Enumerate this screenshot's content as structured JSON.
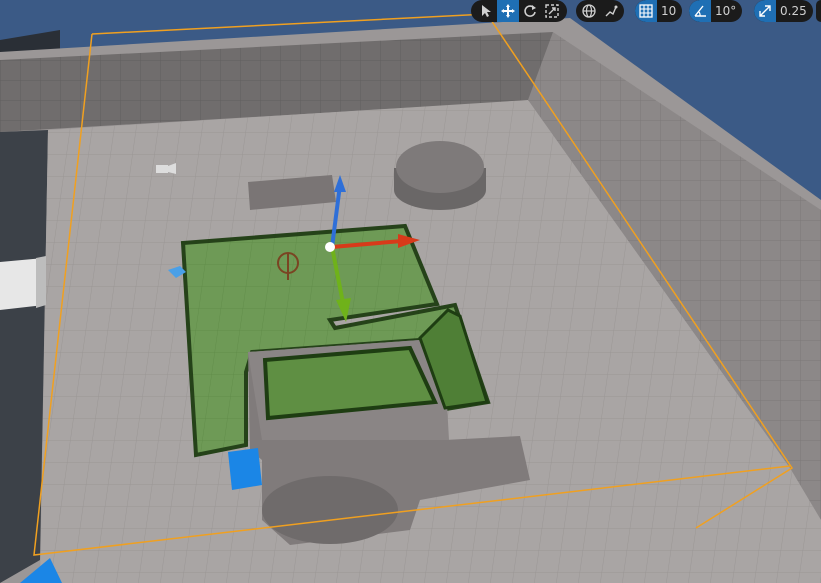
{
  "toolbar": {
    "tools": [
      "select-tool",
      "translate-tool",
      "rotate-tool",
      "scale-tool"
    ],
    "active_tool": "translate-tool",
    "coordinate_space": "world",
    "grid_snap_value": "10",
    "rotation_snap_value": "10°",
    "scale_snap_value": "0.25"
  },
  "colors": {
    "selection_green": "#5c8f3f",
    "bounds_orange": "#f0a020",
    "axis_x": "#d83a1a",
    "axis_y": "#6fb21a",
    "axis_z": "#2e6fd8",
    "toolbar_bg": "#1b1b1b",
    "toolbar_active": "#1f6fb4"
  }
}
